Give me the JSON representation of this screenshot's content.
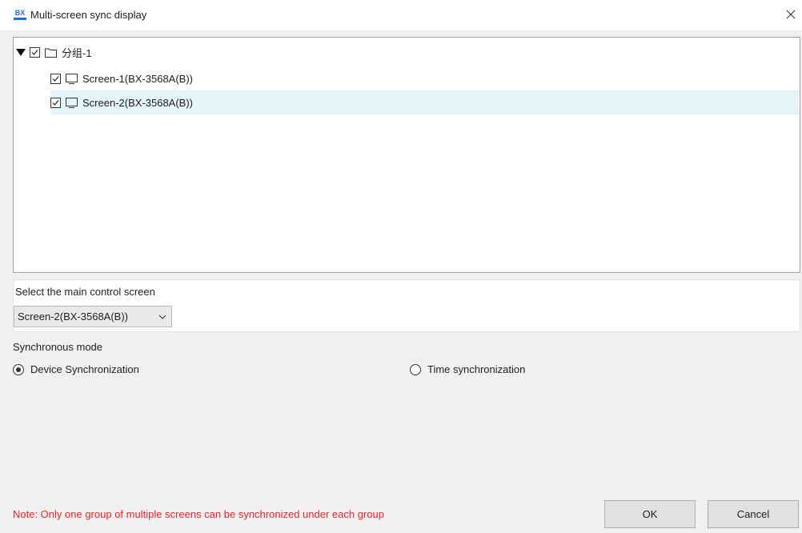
{
  "window": {
    "title": "Multi-screen sync display",
    "logo_text": "BX",
    "accent_color": "#1f6fd8"
  },
  "tree": {
    "group": {
      "label": "分组-1",
      "expanded": true,
      "checked": true,
      "icon": "folder-icon"
    },
    "screens": [
      {
        "label": "Screen-1(BX-3568A(B))",
        "checked": true,
        "selected": false,
        "icon": "monitor-icon"
      },
      {
        "label": "Screen-2(BX-3568A(B))",
        "checked": true,
        "selected": true,
        "icon": "monitor-icon"
      }
    ]
  },
  "main_control": {
    "label": "Select the main control screen",
    "selected_value": "Screen-2(BX-3568A(B))"
  },
  "sync_mode": {
    "label": "Synchronous mode",
    "options": [
      {
        "label": "Device Synchronization",
        "checked": true
      },
      {
        "label": "Time synchronization",
        "checked": false
      }
    ]
  },
  "footer": {
    "note": "Note: Only one group of multiple screens can be synchronized under each group",
    "note_color": "#e8252d",
    "ok_label": "OK",
    "cancel_label": "Cancel"
  }
}
